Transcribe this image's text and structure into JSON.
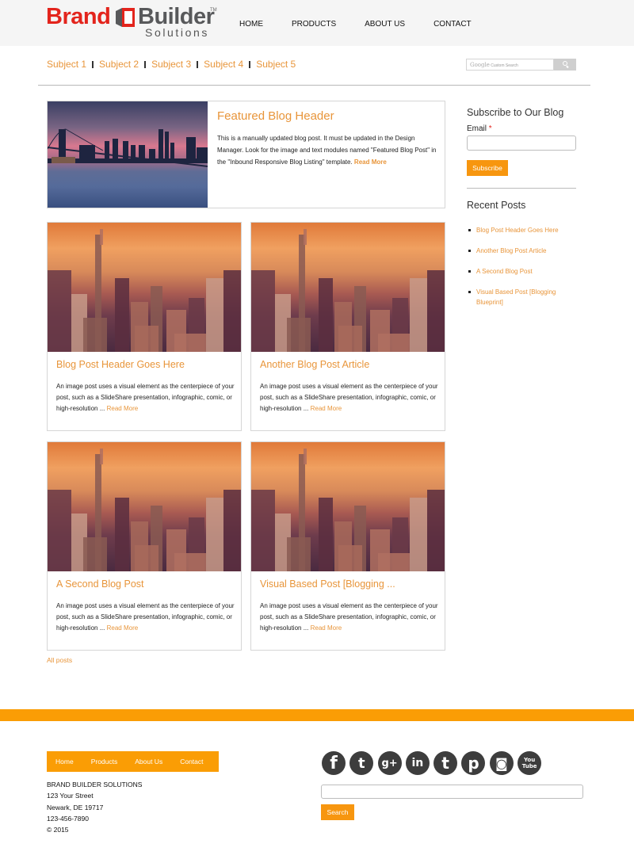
{
  "header": {
    "logo": {
      "brand": "Brand",
      "builder": "Builder",
      "tm": "TM",
      "solutions": "Solutions"
    },
    "nav": [
      "HOME",
      "PRODUCTS",
      "ABOUT US",
      "CONTACT"
    ]
  },
  "subjects": [
    "Subject 1",
    "Subject 2",
    "Subject 3",
    "Subject 4",
    "Subject 5"
  ],
  "site_search": {
    "brand": "Google",
    "placeholder": "Custom Search",
    "button_icon": "search-icon"
  },
  "featured": {
    "title": "Featured Blog Header",
    "body": "This is a manually updated blog post. It must be updated in the Design Manager. Look for the image and text modules named \"Featured Blog Post\" in the \"Inbound Responsive Blog Listing\" template.",
    "read_more": "Read More"
  },
  "posts": [
    {
      "title": "Blog Post Header Goes Here",
      "excerpt": "An image post uses a visual element as the centerpiece of your post, such as a SlideShare presentation, infographic, comic, or high-resolution ...",
      "read_more": "Read More"
    },
    {
      "title": "Another Blog Post Article",
      "excerpt": "An image post uses a visual element as the centerpiece of your post, such as a SlideShare presentation, infographic, comic, or high-resolution ...",
      "read_more": "Read More"
    },
    {
      "title": "A Second Blog Post",
      "excerpt": "An image post uses a visual element as the centerpiece of your post, such as a SlideShare presentation, infographic, comic, or high-resolution ...",
      "read_more": "Read More"
    },
    {
      "title": "Visual Based Post [Blogging ...",
      "excerpt": "An image post uses a visual element as the centerpiece of your post, such as a SlideShare presentation, infographic, comic, or high-resolution ...",
      "read_more": "Read More"
    }
  ],
  "all_posts": "All posts",
  "sidebar": {
    "subscribe_title": "Subscribe to Our Blog",
    "email_label": "Email",
    "required_mark": "*",
    "email_value": "",
    "subscribe_button": "Subscribe",
    "recent_title": "Recent Posts",
    "recent_posts": [
      "Blog Post Header Goes Here",
      "Another Blog Post Article",
      "A Second Blog Post",
      "Visual Based Post [Blogging Blueprint]"
    ]
  },
  "footer": {
    "nav": [
      "Home",
      "Products",
      "About Us",
      "Contact"
    ],
    "address": [
      "BRAND BUILDER SOLUTIONS",
      "123 Your Street",
      "Newark, DE 19717",
      "123-456-7890",
      "© 2015"
    ],
    "social": [
      {
        "name": "facebook",
        "glyph": "f"
      },
      {
        "name": "twitter",
        "glyph": "t"
      },
      {
        "name": "google-plus",
        "glyph": "g+"
      },
      {
        "name": "linkedin",
        "glyph": "in"
      },
      {
        "name": "tumblr",
        "glyph": "t"
      },
      {
        "name": "pinterest",
        "glyph": "p"
      },
      {
        "name": "instagram",
        "glyph": "◙"
      },
      {
        "name": "youtube",
        "glyph": "You Tube"
      }
    ],
    "search_value": "",
    "search_button": "Search"
  },
  "colors": {
    "accent": "#e8953a",
    "button": "#f7960f",
    "footer_bar": "#fa9d05",
    "logo_red": "#e3241c",
    "logo_gray": "#58595b"
  }
}
